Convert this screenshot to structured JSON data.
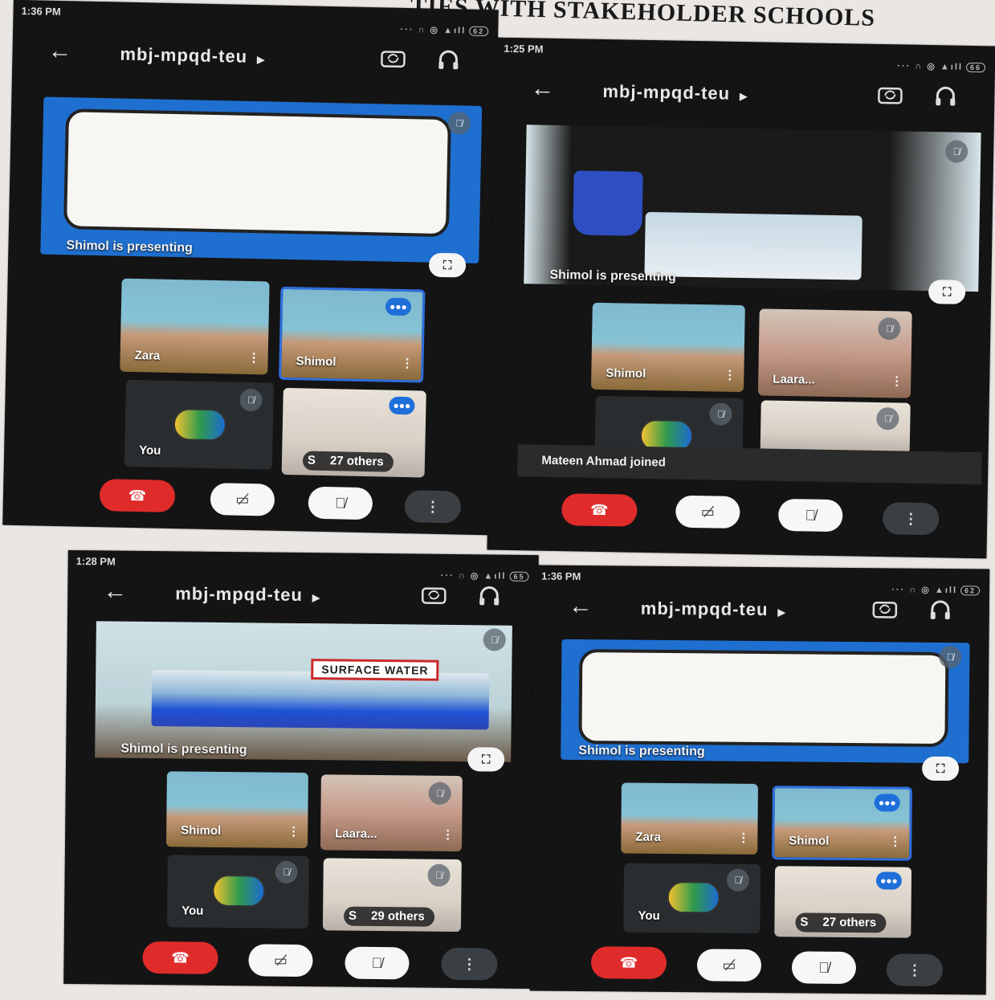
{
  "page_heading": "…TIES WITH STAKEHOLDER SCHOOLS",
  "screens": [
    {
      "time": "1:36 PM",
      "battery": "62",
      "meeting_code": "mbj-mpqd-teu",
      "presenting_label": "Shimol is presenting",
      "tiles": [
        {
          "name": "Zara"
        },
        {
          "name": "Shimol"
        },
        {
          "name": "You"
        },
        {
          "name": "S",
          "others_label": "27 others"
        }
      ]
    },
    {
      "time": "1:25 PM",
      "battery": "66",
      "meeting_code": "mbj-mpqd-teu",
      "presenting_label": "Shimol is presenting",
      "tiles": [
        {
          "name": "Shimol"
        },
        {
          "name": "Laara..."
        },
        {
          "name": ""
        },
        {
          "name": ""
        }
      ],
      "toast": "Mateen Ahmad joined"
    },
    {
      "time": "1:28 PM",
      "battery": "65",
      "meeting_code": "mbj-mpqd-teu",
      "presenting_label": "Shimol is presenting",
      "slide_label": "SURFACE WATER",
      "tiles": [
        {
          "name": "Shimol"
        },
        {
          "name": "Laara..."
        },
        {
          "name": "You"
        },
        {
          "name": "S",
          "others_label": "29 others"
        }
      ]
    },
    {
      "time": "1:36 PM",
      "battery": "62",
      "meeting_code": "mbj-mpqd-teu",
      "presenting_label": "Shimol is presenting",
      "tiles": [
        {
          "name": "Zara"
        },
        {
          "name": "Shimol"
        },
        {
          "name": "You"
        },
        {
          "name": "S",
          "others_label": "27 others"
        }
      ]
    }
  ],
  "icons": {
    "back": "arrow-left-icon",
    "camera_flip": "camera-flip-icon",
    "audio": "headphones-icon",
    "end_call": "phone-hangup-icon",
    "camera_off": "video-off-icon",
    "mic_off": "mic-off-icon",
    "more": "more-vertical-icon",
    "expand": "fullscreen-icon"
  },
  "colors": {
    "end_call": "#e02b2b",
    "active_speaker": "#2f6fe0",
    "app_background": "#141414"
  }
}
